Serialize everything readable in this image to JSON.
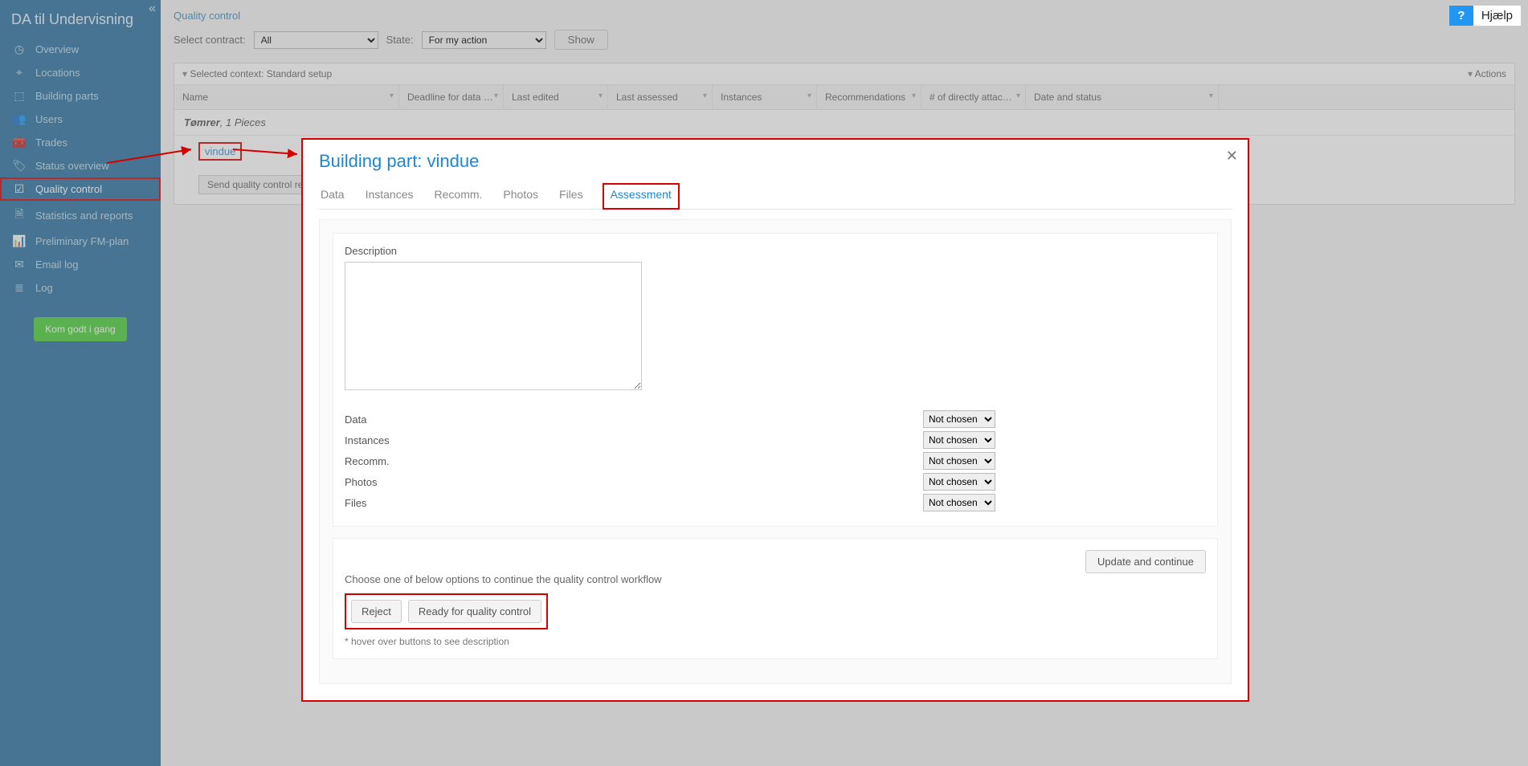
{
  "sidebar": {
    "title": "DA til Undervisning",
    "items": [
      {
        "label": "Overview"
      },
      {
        "label": "Locations"
      },
      {
        "label": "Building parts"
      },
      {
        "label": "Users"
      },
      {
        "label": "Trades"
      },
      {
        "label": "Status overview"
      },
      {
        "label": "Quality control"
      },
      {
        "label": "Statistics and reports"
      },
      {
        "label": "Preliminary FM-plan"
      },
      {
        "label": "Email log"
      },
      {
        "label": "Log"
      }
    ],
    "cta": "Kom godt i gang"
  },
  "breadcrumb": "Quality control",
  "filters": {
    "contract_label": "Select contract:",
    "contract_value": "All",
    "state_label": "State:",
    "state_value": "For my action",
    "show_btn": "Show"
  },
  "grid": {
    "context_label": "Selected context: Standard setup",
    "actions_label": "Actions",
    "columns": [
      "Name",
      "Deadline for data e...",
      "Last edited",
      "Last assessed",
      "Instances",
      "Recommendations",
      "# of directly attache...",
      "Date and status"
    ],
    "group": {
      "trade": "Tømrer",
      "count_label": "1 Pieces"
    },
    "row_link": "vindue",
    "send_btn": "Send quality control report"
  },
  "modal": {
    "title": "Building part: vindue",
    "tabs": [
      "Data",
      "Instances",
      "Recomm.",
      "Photos",
      "Files",
      "Assessment"
    ],
    "active_tab": "Assessment",
    "description_label": "Description",
    "assess_rows": [
      {
        "label": "Data",
        "value": "Not chosen"
      },
      {
        "label": "Instances",
        "value": "Not chosen"
      },
      {
        "label": "Recomm.",
        "value": "Not chosen"
      },
      {
        "label": "Photos",
        "value": "Not chosen"
      },
      {
        "label": "Files",
        "value": "Not chosen"
      }
    ],
    "update_btn": "Update and continue",
    "workflow_text": "Choose one of below options to continue the quality control workflow",
    "reject_btn": "Reject",
    "ready_btn": "Ready for quality control",
    "hint": "* hover over buttons to see description"
  },
  "help": {
    "q": "?",
    "label": "Hjælp"
  }
}
